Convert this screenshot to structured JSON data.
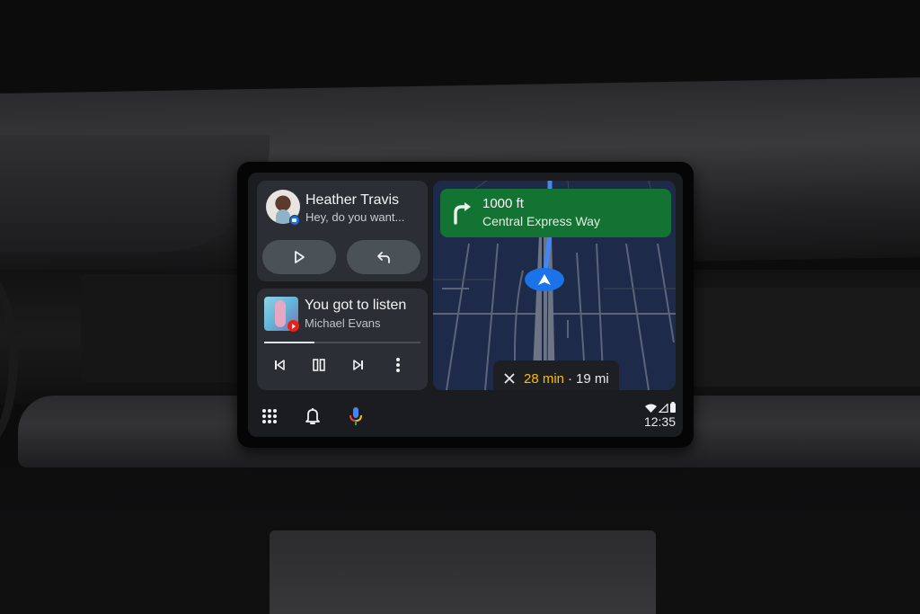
{
  "message_card": {
    "contact_name": "Heather Travis",
    "message_preview": "Hey, do you want...",
    "avatar_icon": "contact-avatar",
    "badge_icon": "messages-app-icon",
    "actions": [
      {
        "icon": "play-icon",
        "label": "Play message"
      },
      {
        "icon": "reply-icon",
        "label": "Reply"
      }
    ]
  },
  "media_card": {
    "track_title": "You got to listen",
    "artist": "Michael Evans",
    "source_badge_icon": "youtube-music-icon",
    "progress_fraction": 0.32,
    "controls": [
      {
        "icon": "skip-previous-icon"
      },
      {
        "icon": "pause-icon"
      },
      {
        "icon": "skip-next-icon"
      },
      {
        "icon": "more-vert-icon"
      }
    ]
  },
  "navigation": {
    "distance": "1000 ft",
    "street": "Central Express Way",
    "turn_icon": "turn-right-icon",
    "eta_time": "28 min",
    "separator": "·",
    "eta_distance": "19 mi",
    "colors": {
      "guidance": "#137333",
      "route": "#4285f4",
      "eta": "#fbbc04",
      "map": "#1e2a4a"
    }
  },
  "rail": {
    "items": [
      {
        "icon": "app-launcher-icon"
      },
      {
        "icon": "notification-bell-icon"
      },
      {
        "icon": "google-assistant-mic-icon"
      }
    ],
    "status_icons": [
      "wifi-icon",
      "cellular-signal-icon",
      "battery-icon"
    ],
    "clock": "12:35"
  }
}
